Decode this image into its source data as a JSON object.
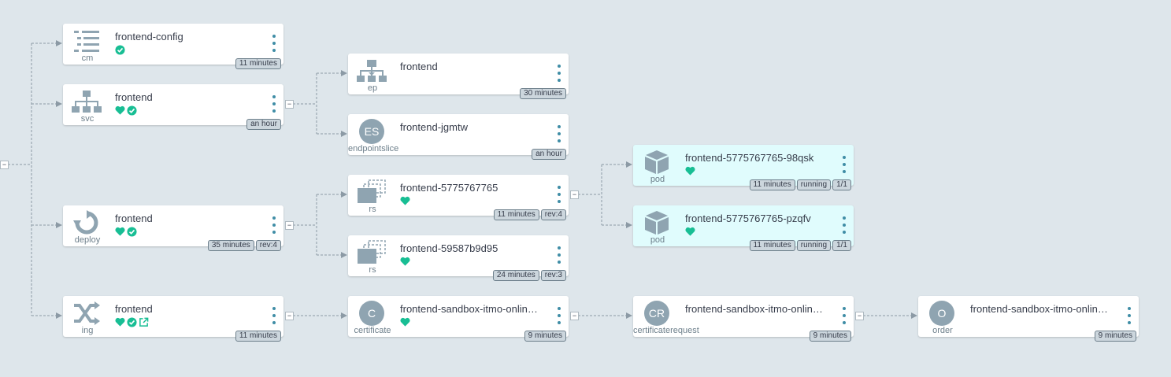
{
  "nodes": [
    {
      "kind": "cm",
      "name": "frontend-config",
      "status": [
        "check"
      ],
      "tags": [
        "11 minutes"
      ],
      "icon": "config-map-icon"
    },
    {
      "kind": "svc",
      "name": "frontend",
      "status": [
        "heart",
        "check"
      ],
      "tags": [
        "an hour"
      ],
      "icon": "service-icon"
    },
    {
      "kind": "deploy",
      "name": "frontend",
      "status": [
        "heart",
        "check"
      ],
      "tags": [
        "35 minutes",
        "rev:4"
      ],
      "icon": "deploy-icon"
    },
    {
      "kind": "ing",
      "name": "frontend",
      "status": [
        "heart",
        "check",
        "link"
      ],
      "tags": [
        "11 minutes"
      ],
      "icon": "ingress-icon"
    },
    {
      "kind": "ep",
      "name": "frontend",
      "status": [],
      "tags": [
        "30 minutes"
      ],
      "icon": "endpoint-icon"
    },
    {
      "kind": "endpointslice",
      "name": "frontend-jgmtw",
      "status": [],
      "tags": [
        "an hour"
      ],
      "icon": "ES"
    },
    {
      "kind": "rs",
      "name": "frontend-5775767765",
      "status": [
        "heart"
      ],
      "tags": [
        "11 minutes",
        "rev:4"
      ],
      "icon": "replicaset-icon"
    },
    {
      "kind": "rs",
      "name": "frontend-59587b9d95",
      "status": [
        "heart"
      ],
      "tags": [
        "24 minutes",
        "rev:3"
      ],
      "icon": "replicaset-icon"
    },
    {
      "kind": "certificate",
      "name": "frontend-sandbox-itmo-online-tls",
      "status": [
        "heart"
      ],
      "tags": [
        "9 minutes"
      ],
      "icon": "C"
    },
    {
      "kind": "pod",
      "name": "frontend-5775767765-98qsk",
      "status": [
        "heart"
      ],
      "tags": [
        "11 minutes",
        "running",
        "1/1"
      ],
      "icon": "pod-icon"
    },
    {
      "kind": "pod",
      "name": "frontend-5775767765-pzqfv",
      "status": [
        "heart"
      ],
      "tags": [
        "11 minutes",
        "running",
        "1/1"
      ],
      "icon": "pod-icon"
    },
    {
      "kind": "certificaterequest",
      "name": "frontend-sandbox-itmo-online-tls",
      "status": [],
      "tags": [
        "9 minutes"
      ],
      "icon": "CR"
    },
    {
      "kind": "order",
      "name": "frontend-sandbox-itmo-online-tls",
      "status": [],
      "tags": [
        "9 minutes"
      ],
      "icon": "O"
    }
  ],
  "colors": {
    "healthy": "#18be94",
    "icon": "#8fa4b1",
    "link": "#0dadea",
    "edge": "#8c9aa5"
  }
}
